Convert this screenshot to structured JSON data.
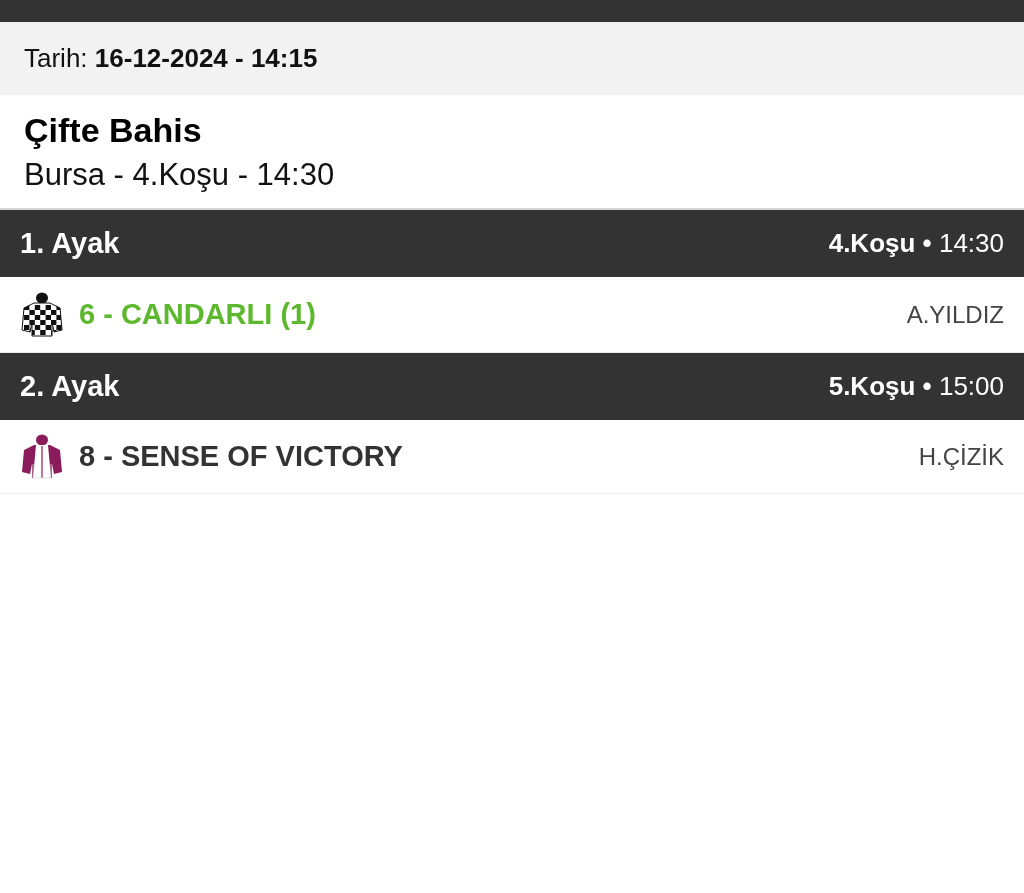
{
  "date_bar": {
    "text": "Tarih: **16-12-2024 - 14:15**"
  },
  "bet": {
    "title": "Çifte Bahis",
    "subtitle": "Bursa - 4.Koşu - 14:30"
  },
  "legs": [
    {
      "label": "1. Ayak",
      "race_info": "**4.Koşu •** 14:30",
      "runner": {
        "name": "6 - CANDARLI (1)",
        "jockey": "A.YILDIZ",
        "winner": true,
        "silk": {
          "kind": "checkered",
          "color": "#111111"
        }
      }
    },
    {
      "label": "2. Ayak",
      "race_info": "**5.Koşu •** 15:00",
      "runner": {
        "name": "8 - SENSE OF VICTORY",
        "jockey": "H.ÇİZİK",
        "winner": false,
        "silk": {
          "kind": "panels",
          "color": "#8a1c5c"
        }
      }
    }
  ]
}
